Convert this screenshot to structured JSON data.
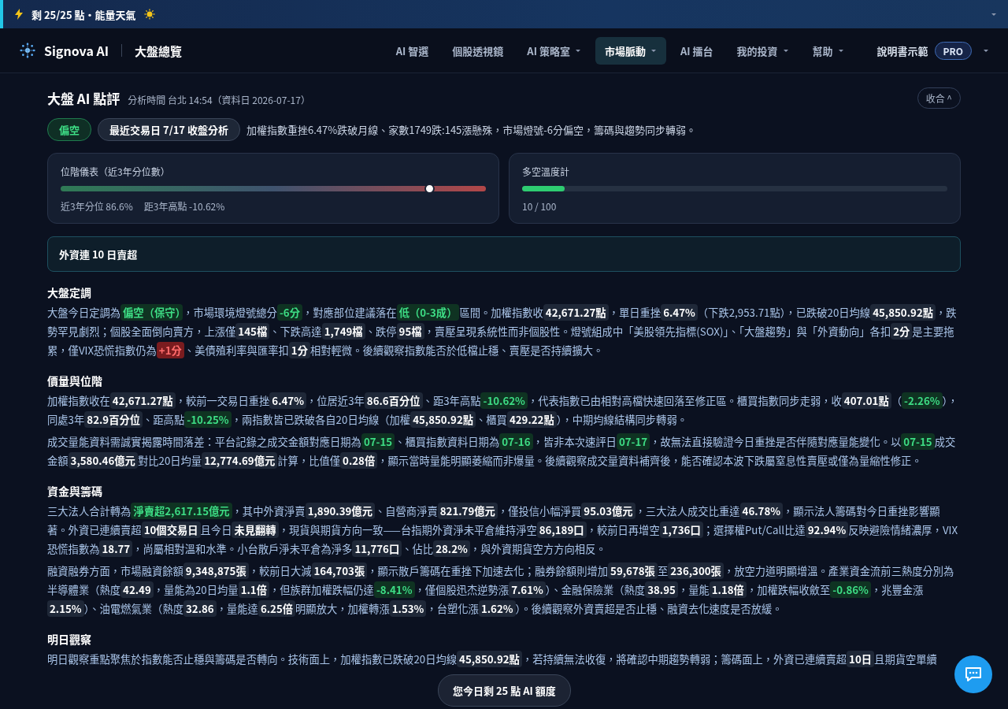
{
  "banner": {
    "text": "剩 25/25 點・能量天氣"
  },
  "nav": {
    "brand": "Signova AI",
    "page": "大盤總覽",
    "items": [
      {
        "label": "AI 智選",
        "selected": false,
        "menu": false
      },
      {
        "label": "個股透視鏡",
        "selected": false,
        "menu": false
      },
      {
        "label": "AI 策略室",
        "selected": false,
        "menu": true
      },
      {
        "label": "市場脈動",
        "selected": true,
        "menu": true
      },
      {
        "label": "AI 擂台",
        "selected": false,
        "menu": false
      },
      {
        "label": "我的投資",
        "selected": false,
        "menu": true
      },
      {
        "label": "幫助",
        "selected": false,
        "menu": true
      }
    ],
    "user": "說明書示範",
    "plan": "PRO"
  },
  "review": {
    "title": "大盤 AI 點評",
    "meta": "分析時間 台北 14:54（資料日 2026-07-17）",
    "collapse": "收合 ^",
    "stance": "偏空",
    "session": "最近交易日 7/17 收盤分析",
    "summary": "加權指數重挫6.47%跌破月線、家數1749跌:145漲懸殊，市場燈號-6分偏空，籌碼與趨勢同步轉弱。",
    "gauges": [
      {
        "kind": "position",
        "title": "位階儀表（近3年分位數）",
        "level": 0.866,
        "readings": [
          "近3年分位 86.6%",
          "距3年高點 -10.62%"
        ]
      },
      {
        "kind": "temperature",
        "title": "多空溫度計",
        "level": 0.1,
        "readings": [
          "10 / 100"
        ]
      }
    ],
    "alert": "外資連 10 日賣超",
    "sections": [
      {
        "heading": "大盤定調",
        "paragraphs": [
          [
            {
              "kind": "text",
              "text": "大盤今日定調為"
            },
            {
              "kind": "bear",
              "text": "偏空（保守）"
            },
            {
              "kind": "text",
              "text": "，市場環境燈號總分"
            },
            {
              "kind": "bear",
              "text": "-6分"
            },
            {
              "kind": "text",
              "text": "，對應部位建議落在"
            },
            {
              "kind": "bear",
              "text": "低（0-3成）"
            },
            {
              "kind": "text",
              "text": "區間。加權指數收"
            },
            {
              "kind": "value",
              "text": "42,671.27點"
            },
            {
              "kind": "text",
              "text": "，單日重挫"
            },
            {
              "kind": "value",
              "text": "6.47%"
            },
            {
              "kind": "text",
              "text": "（下跌2,953.71點），已跌破20日均線"
            },
            {
              "kind": "value",
              "text": "45,850.92點"
            },
            {
              "kind": "text",
              "text": "，跌勢罕見劇烈；個股全面倒向賣方，上漲僅"
            },
            {
              "kind": "value",
              "text": "145檔"
            },
            {
              "kind": "text",
              "text": "、下跌高達"
            },
            {
              "kind": "value",
              "text": "1,749檔"
            },
            {
              "kind": "text",
              "text": "、跌停"
            },
            {
              "kind": "value",
              "text": "95檔"
            },
            {
              "kind": "text",
              "text": "，賣壓呈現系統性而非個股性。燈號組成中「美股領先指標(SOX)」、「大盤趨勢」與「外資動向」各扣"
            },
            {
              "kind": "value",
              "text": "2分"
            },
            {
              "kind": "text",
              "text": "是主要拖累，僅VIX恐慌指數仍為"
            },
            {
              "kind": "bull",
              "text": "+1分"
            },
            {
              "kind": "text",
              "text": "、美債殖利率與匯率扣"
            },
            {
              "kind": "value",
              "text": "1分"
            },
            {
              "kind": "text",
              "text": "相對輕微。後續觀察指數能否於低檔止穩、賣壓是否持續擴大。"
            }
          ]
        ]
      },
      {
        "heading": "價量與位階",
        "paragraphs": [
          [
            {
              "kind": "text",
              "text": "加權指數收在"
            },
            {
              "kind": "value",
              "text": "42,671.27點"
            },
            {
              "kind": "text",
              "text": "，較前一交易日重挫"
            },
            {
              "kind": "value",
              "text": "6.47%"
            },
            {
              "kind": "text",
              "text": "，位居近3年"
            },
            {
              "kind": "value",
              "text": "86.6百分位"
            },
            {
              "kind": "text",
              "text": "、距3年高點"
            },
            {
              "kind": "bear",
              "text": "-10.62%"
            },
            {
              "kind": "text",
              "text": "，代表指數已由相對高檔快速回落至修正區。櫃買指數同步走弱，收"
            },
            {
              "kind": "value",
              "text": "407.01點"
            },
            {
              "kind": "text",
              "text": "（"
            },
            {
              "kind": "bear",
              "text": "-2.26%"
            },
            {
              "kind": "text",
              "text": "），同處3年"
            },
            {
              "kind": "value",
              "text": "82.9百分位"
            },
            {
              "kind": "text",
              "text": "、距高點"
            },
            {
              "kind": "bear",
              "text": "-10.25%"
            },
            {
              "kind": "text",
              "text": "，兩指數皆已跌破各自20日均線（加權"
            },
            {
              "kind": "value",
              "text": "45,850.92點"
            },
            {
              "kind": "text",
              "text": "、櫃買"
            },
            {
              "kind": "value",
              "text": "429.22點"
            },
            {
              "kind": "text",
              "text": "），中期均線結構同步轉弱。"
            }
          ],
          [
            {
              "kind": "text",
              "text": "成交量能資料需誠實揭露時間落差：平台記錄之成交金額對應日期為"
            },
            {
              "kind": "bear",
              "text": "07-15"
            },
            {
              "kind": "text",
              "text": "、櫃買指數資料日期為"
            },
            {
              "kind": "bear",
              "text": "07-16"
            },
            {
              "kind": "text",
              "text": "，皆非本次速評日"
            },
            {
              "kind": "bear",
              "text": "07-17"
            },
            {
              "kind": "text",
              "text": "，故無法直接驗證今日重挫是否伴隨對應量能變化。以"
            },
            {
              "kind": "bear",
              "text": "07-15"
            },
            {
              "kind": "text",
              "text": "成交金額"
            },
            {
              "kind": "value",
              "text": "3,580.46億元"
            },
            {
              "kind": "text",
              "text": "對比20日均量"
            },
            {
              "kind": "value",
              "text": "12,774.69億元"
            },
            {
              "kind": "text",
              "text": "計算，比值僅"
            },
            {
              "kind": "value",
              "text": "0.28倍"
            },
            {
              "kind": "text",
              "text": "，顯示當時量能明顯萎縮而非爆量。後續觀察成交量資料補齊後，能否確認本波下跌屬窒息性賣壓或僅為量縮性修正。"
            }
          ]
        ]
      },
      {
        "heading": "資金與籌碼",
        "paragraphs": [
          [
            {
              "kind": "text",
              "text": "三大法人合計轉為"
            },
            {
              "kind": "bear",
              "text": "淨賣超2,617.15億元"
            },
            {
              "kind": "text",
              "text": "，其中外資淨賣"
            },
            {
              "kind": "value",
              "text": "1,890.39億元"
            },
            {
              "kind": "text",
              "text": "、自營商淨賣"
            },
            {
              "kind": "value",
              "text": "821.79億元"
            },
            {
              "kind": "text",
              "text": "，僅投信小幅淨買"
            },
            {
              "kind": "value",
              "text": "95.03億元"
            },
            {
              "kind": "text",
              "text": "，三大法人成交比重達"
            },
            {
              "kind": "value",
              "text": "46.78%"
            },
            {
              "kind": "text",
              "text": "，顯示法人籌碼對今日重挫影響顯著。外資已連續賣超"
            },
            {
              "kind": "value",
              "text": "10個交易日"
            },
            {
              "kind": "text",
              "text": "且今日"
            },
            {
              "kind": "value",
              "text": "未見翻轉"
            },
            {
              "kind": "text",
              "text": "，現貨與期貨方向一致——台指期外資淨未平倉維持淨空"
            },
            {
              "kind": "value",
              "text": "86,189口"
            },
            {
              "kind": "text",
              "text": "，較前日再增空"
            },
            {
              "kind": "value",
              "text": "1,736口"
            },
            {
              "kind": "text",
              "text": "；選擇權Put/Call比達"
            },
            {
              "kind": "value",
              "text": "92.94%"
            },
            {
              "kind": "text",
              "text": "反映避險情緒濃厚，VIX恐慌指數為"
            },
            {
              "kind": "value",
              "text": "18.77"
            },
            {
              "kind": "text",
              "text": "，尚屬相對溫和水準。小台散戶淨未平倉為淨多"
            },
            {
              "kind": "value",
              "text": "11,776口"
            },
            {
              "kind": "text",
              "text": "、佔比"
            },
            {
              "kind": "value",
              "text": "28.2%"
            },
            {
              "kind": "text",
              "text": "，與外資期貨空方方向相反。"
            }
          ],
          [
            {
              "kind": "text",
              "text": "融資融券方面，市場融資餘額"
            },
            {
              "kind": "value",
              "text": "9,348,875張"
            },
            {
              "kind": "text",
              "text": "，較前日大減"
            },
            {
              "kind": "value",
              "text": "164,703張"
            },
            {
              "kind": "text",
              "text": "，顯示散戶籌碼在重挫下加速去化；融券餘額則增加"
            },
            {
              "kind": "value",
              "text": "59,678張"
            },
            {
              "kind": "text",
              "text": "至"
            },
            {
              "kind": "value",
              "text": "236,300張"
            },
            {
              "kind": "text",
              "text": "，放空力道明顯增溫。產業資金流前三熱度分別為半導體業（熱度"
            },
            {
              "kind": "value",
              "text": "42.49"
            },
            {
              "kind": "text",
              "text": "，量能為20日均量"
            },
            {
              "kind": "value",
              "text": "1.1倍"
            },
            {
              "kind": "text",
              "text": "，但族群加權跌幅仍達"
            },
            {
              "kind": "bear",
              "text": "-8.41%"
            },
            {
              "kind": "text",
              "text": "，僅個股迅杰逆勢漲"
            },
            {
              "kind": "value",
              "text": "7.61%"
            },
            {
              "kind": "text",
              "text": "）、金融保險業（熱度"
            },
            {
              "kind": "value",
              "text": "38.95"
            },
            {
              "kind": "text",
              "text": "，量能"
            },
            {
              "kind": "value",
              "text": "1.18倍"
            },
            {
              "kind": "text",
              "text": "，加權跌幅收斂至"
            },
            {
              "kind": "bear",
              "text": "-0.86%"
            },
            {
              "kind": "text",
              "text": "，兆豐金漲"
            },
            {
              "kind": "value",
              "text": "2.15%"
            },
            {
              "kind": "text",
              "text": "）、油電燃氣業（熱度"
            },
            {
              "kind": "value",
              "text": "32.86"
            },
            {
              "kind": "text",
              "text": "，量能達"
            },
            {
              "kind": "value",
              "text": "6.25倍"
            },
            {
              "kind": "text",
              "text": "明顯放大，加權轉漲"
            },
            {
              "kind": "value",
              "text": "1.53%"
            },
            {
              "kind": "text",
              "text": "，台塑化漲"
            },
            {
              "kind": "value",
              "text": "1.62%"
            },
            {
              "kind": "text",
              "text": "）。後續觀察外資賣超是否止穩、融資去化速度是否放緩。"
            }
          ]
        ]
      },
      {
        "heading": "明日觀察",
        "paragraphs": [
          [
            {
              "kind": "text",
              "text": "明日觀察重點聚焦於指數能否止穩與籌碼是否轉向。技術面上，加權指數已跌破20日均線"
            },
            {
              "kind": "value",
              "text": "45,850.92點"
            },
            {
              "kind": "text",
              "text": "，若持續無法收復，將確認中期趨勢轉弱；籌碼面上，外資已連續賣超"
            },
            {
              "kind": "value",
              "text": "10日"
            },
            {
              "kind": "text",
              "text": "且期貨空單續"
            }
          ]
        ]
      }
    ]
  },
  "toast": "您今日剩 25 點 AI 額度"
}
